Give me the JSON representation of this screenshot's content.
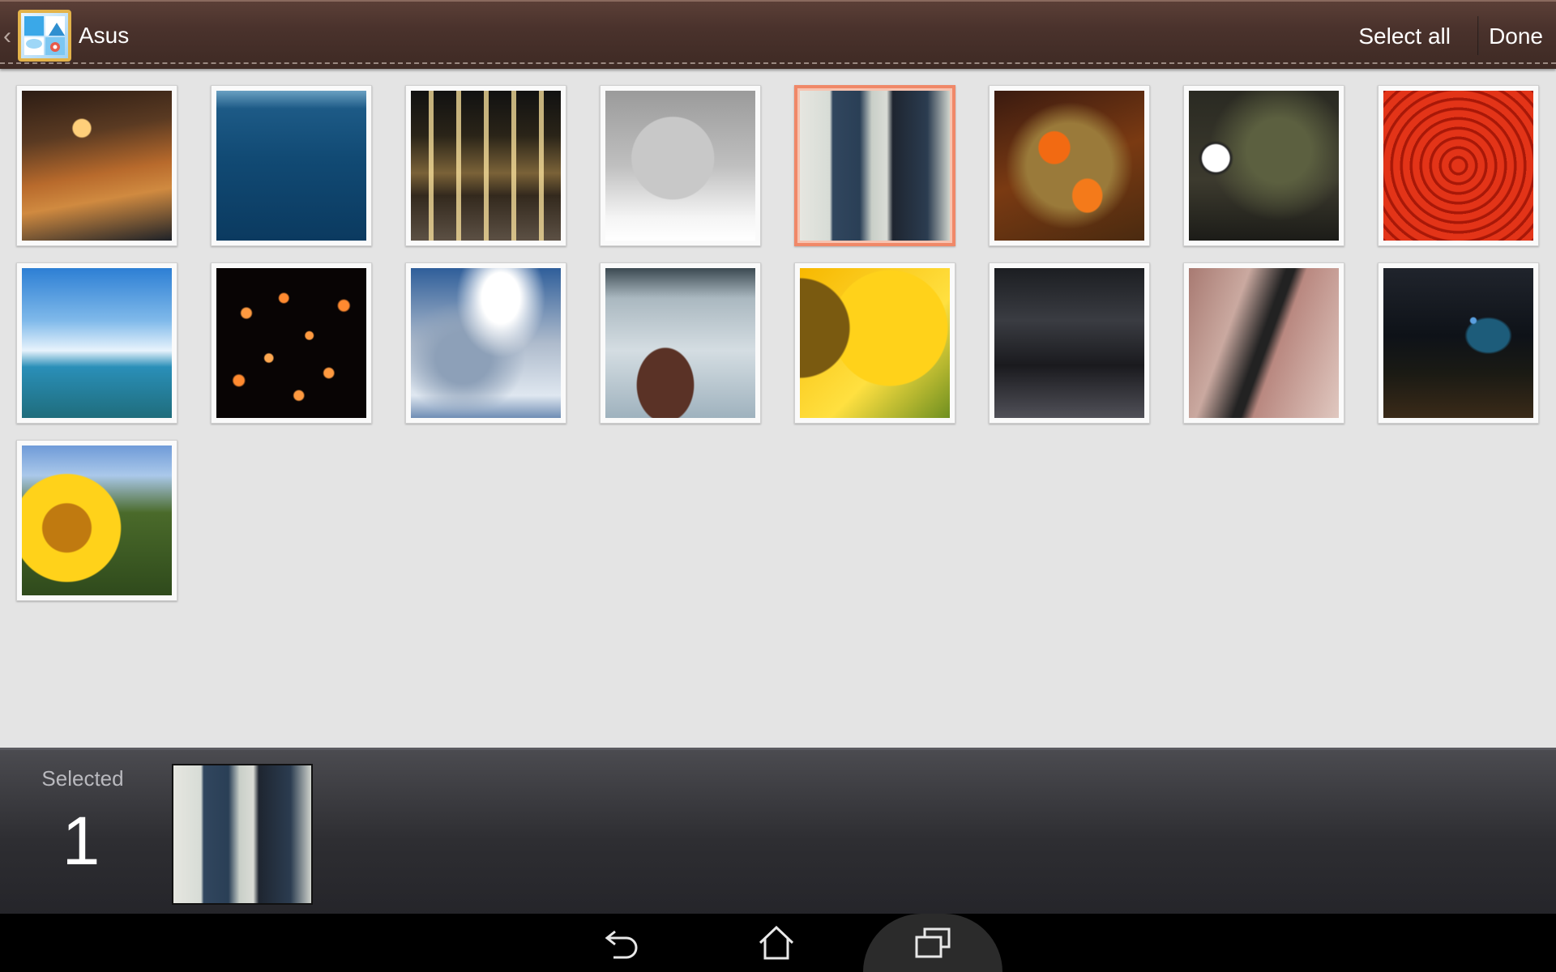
{
  "action_bar": {
    "title": "Asus",
    "select_all_label": "Select all",
    "done_label": "Done"
  },
  "photos": [
    {
      "name": "photo-cafe-interior",
      "selected": false
    },
    {
      "name": "photo-blue-water",
      "selected": false
    },
    {
      "name": "photo-building-night",
      "selected": false
    },
    {
      "name": "photo-sleeping-cat",
      "selected": false
    },
    {
      "name": "photo-couple-walking",
      "selected": true
    },
    {
      "name": "photo-clownfish",
      "selected": false
    },
    {
      "name": "photo-white-flower",
      "selected": false
    },
    {
      "name": "photo-red-lanterns",
      "selected": false
    },
    {
      "name": "photo-harbor-boats",
      "selected": false
    },
    {
      "name": "photo-sky-lanterns",
      "selected": false
    },
    {
      "name": "photo-cloudy-sky",
      "selected": false
    },
    {
      "name": "photo-rock-misty-sea",
      "selected": false
    },
    {
      "name": "photo-sunflower-closeup",
      "selected": false
    },
    {
      "name": "photo-statue",
      "selected": false
    },
    {
      "name": "photo-rain-wood",
      "selected": false
    },
    {
      "name": "photo-city-night",
      "selected": false
    },
    {
      "name": "photo-sunflower-field",
      "selected": false
    }
  ],
  "selection": {
    "label": "Selected",
    "count": "1"
  },
  "colors": {
    "selected_border": "#f08868",
    "action_bar": "#4a322c",
    "background": "#e4e4e4"
  },
  "icons": {
    "back": "back-arrow-icon",
    "home": "home-icon",
    "recents": "recent-apps-icon",
    "app": "gallery-app-icon"
  }
}
